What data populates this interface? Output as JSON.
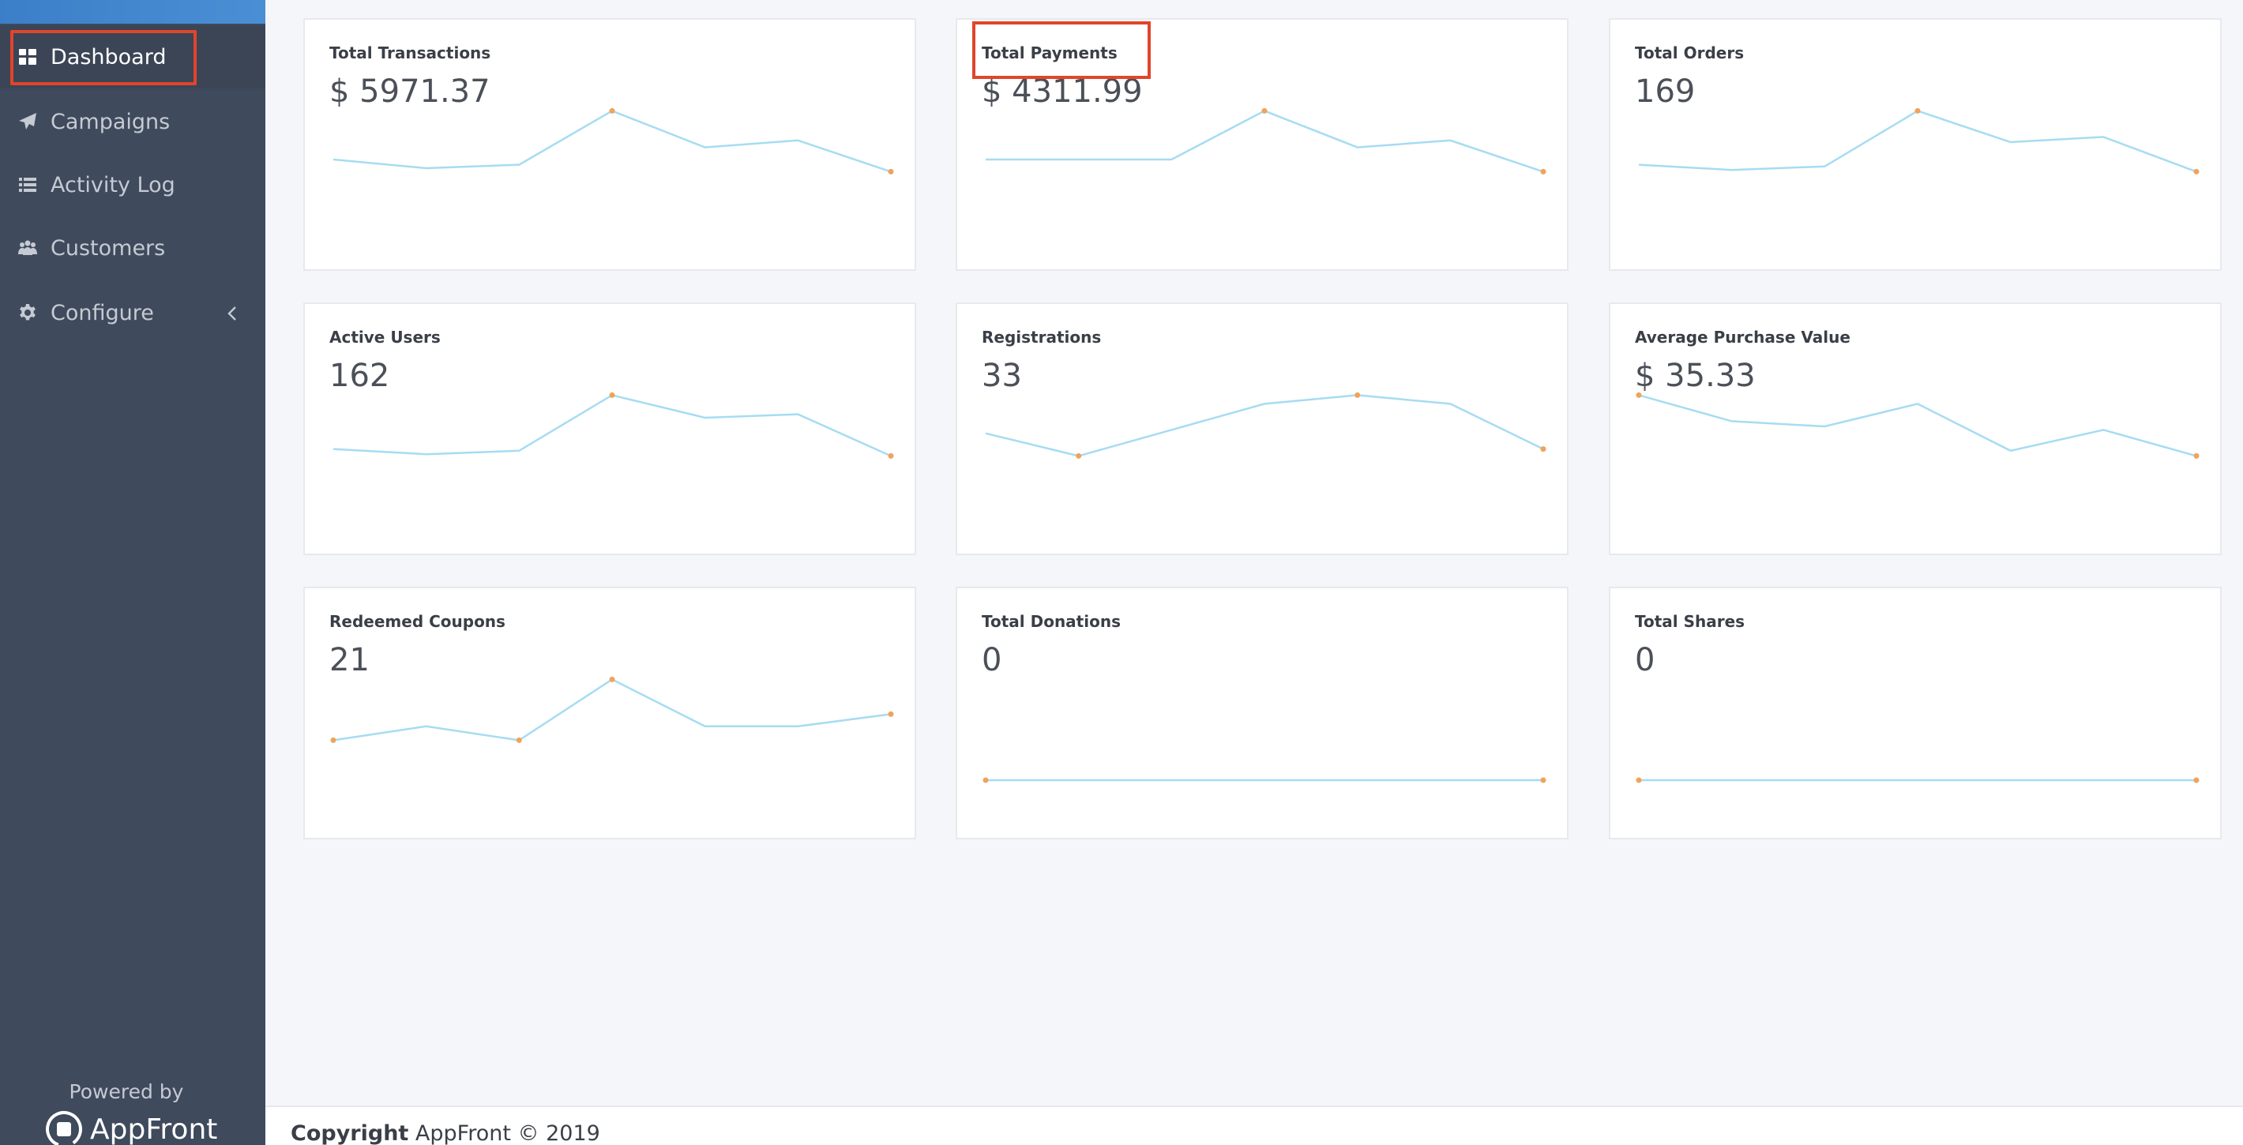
{
  "sidebar": {
    "items": [
      {
        "label": "Dashboard",
        "icon": "grid-icon"
      },
      {
        "label": "Campaigns",
        "icon": "paper-plane-icon"
      },
      {
        "label": "Activity Log",
        "icon": "list-icon"
      },
      {
        "label": "Customers",
        "icon": "users-icon"
      },
      {
        "label": "Configure",
        "icon": "gear-icon"
      }
    ],
    "powered_by": "Powered by",
    "brand_name": "AppFront"
  },
  "cards": [
    {
      "title": "Total Transactions",
      "value": "$ 5971.37",
      "series": [
        0.3,
        0.25,
        0.27,
        0.58,
        0.37,
        0.41,
        0.23
      ]
    },
    {
      "title": "Total Payments",
      "value": "$ 4311.99",
      "series": [
        0.3,
        0.3,
        0.3,
        0.58,
        0.37,
        0.41,
        0.23
      ]
    },
    {
      "title": "Total Orders",
      "value": "169",
      "series": [
        0.27,
        0.24,
        0.26,
        0.58,
        0.4,
        0.43,
        0.23
      ]
    },
    {
      "title": "Active Users",
      "value": "162",
      "series": [
        0.27,
        0.24,
        0.26,
        0.58,
        0.45,
        0.47,
        0.23
      ]
    },
    {
      "title": "Registrations",
      "value": "33",
      "series": [
        0.36,
        0.23,
        0.38,
        0.53,
        0.58,
        0.53,
        0.27
      ]
    },
    {
      "title": "Average Purchase Value",
      "value": "$ 35.33",
      "series": [
        0.58,
        0.43,
        0.4,
        0.53,
        0.26,
        0.38,
        0.23
      ]
    },
    {
      "title": "Redeemed Coupons",
      "value": "21",
      "series": [
        0.23,
        0.31,
        0.23,
        0.58,
        0.31,
        0.31,
        0.38
      ]
    },
    {
      "title": "Total Donations",
      "value": "0",
      "series": [
        0,
        0,
        0,
        0,
        0,
        0,
        0
      ]
    },
    {
      "title": "Total Shares",
      "value": "0",
      "series": [
        0,
        0,
        0,
        0,
        0,
        0,
        0
      ]
    }
  ],
  "colors": {
    "line": "#a6dcf2",
    "marker": "#f0a35a",
    "sidebar_bg": "#3f4a5c",
    "highlight": "#e0452b"
  },
  "footer": {
    "bold": "Copyright",
    "text": " AppFront © 2019"
  }
}
